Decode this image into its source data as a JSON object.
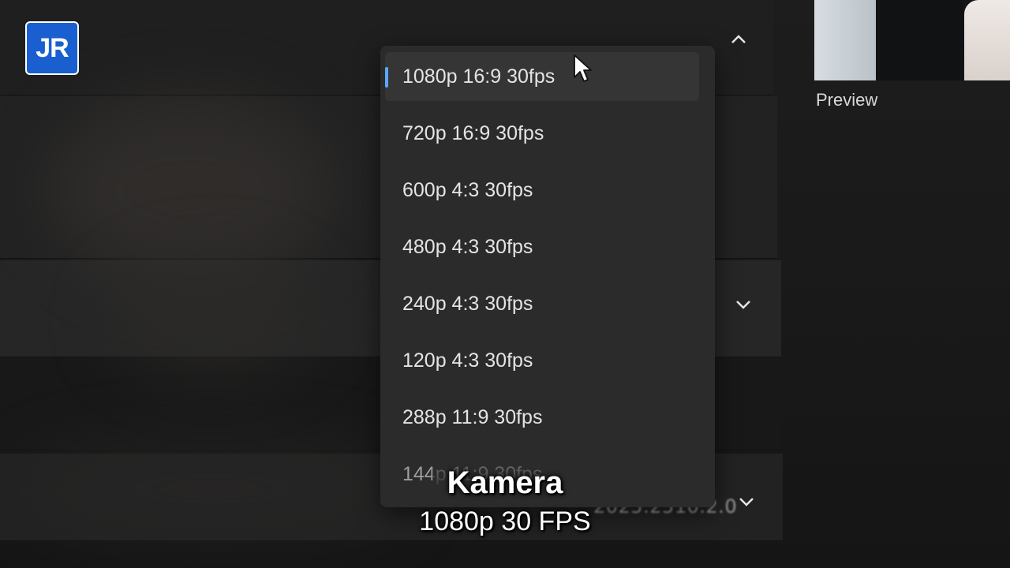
{
  "logo": {
    "text": "JR",
    "color": "#1a5fd0"
  },
  "preview": {
    "label": "Preview"
  },
  "dropdown": {
    "options": [
      {
        "label": "1080p 16:9 30fps",
        "selected": true
      },
      {
        "label": "720p 16:9 30fps"
      },
      {
        "label": "600p 4:3 30fps"
      },
      {
        "label": "480p 4:3 30fps"
      },
      {
        "label": "240p 4:3 30fps"
      },
      {
        "label": "120p 4:3 30fps"
      },
      {
        "label": "288p 11:9 30fps"
      },
      {
        "label": "144p 11:9 30fps"
      }
    ],
    "accent_color": "#5aa8ff"
  },
  "background": {
    "version_text": "2025.2510.2.0",
    "chevrons": [
      "chevron-up-icon",
      "chevron-down-icon",
      "chevron-down-icon"
    ]
  },
  "caption": {
    "title": "Kamera",
    "subtitle": "1080p 30 FPS"
  }
}
